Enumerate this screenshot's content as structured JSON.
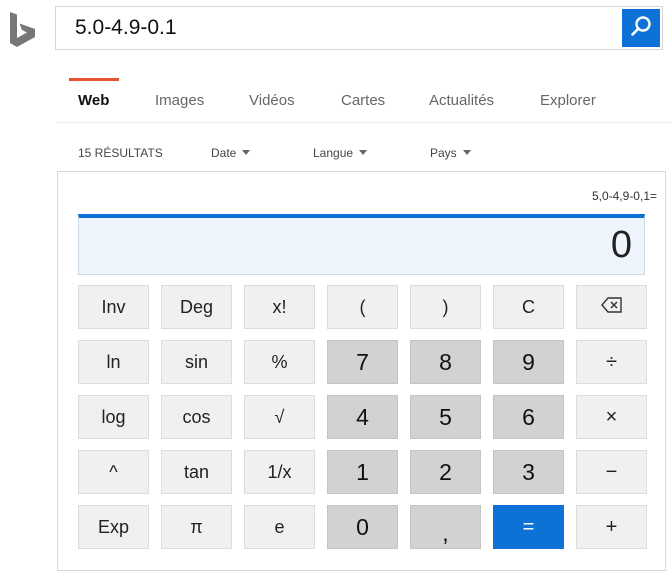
{
  "search": {
    "query": "5.0-4.9-0.1"
  },
  "tabs": [
    {
      "label": "Web",
      "active": true
    },
    {
      "label": "Images"
    },
    {
      "label": "Vidéos"
    },
    {
      "label": "Cartes"
    },
    {
      "label": "Actualités"
    },
    {
      "label": "Explorer"
    }
  ],
  "tools": {
    "results_count": "15 RÉSULTATS",
    "date": "Date",
    "language": "Langue",
    "country": "Pays"
  },
  "calculator": {
    "expression": "5,0-4,9-0,1=",
    "result": "0",
    "rows": [
      [
        "Inv",
        "Deg",
        "x!",
        "(",
        ")",
        "C",
        "⌫"
      ],
      [
        "ln",
        "sin",
        "%",
        "7",
        "8",
        "9",
        "÷"
      ],
      [
        "log",
        "cos",
        "√",
        "4",
        "5",
        "6",
        "×"
      ],
      [
        "^",
        "tan",
        "1/x",
        "1",
        "2",
        "3",
        "−"
      ],
      [
        "Exp",
        "π",
        "e",
        "0",
        ",",
        "=",
        "+"
      ]
    ]
  },
  "colors": {
    "accent": "#0c72d6",
    "tab_underline": "#e6542f"
  }
}
